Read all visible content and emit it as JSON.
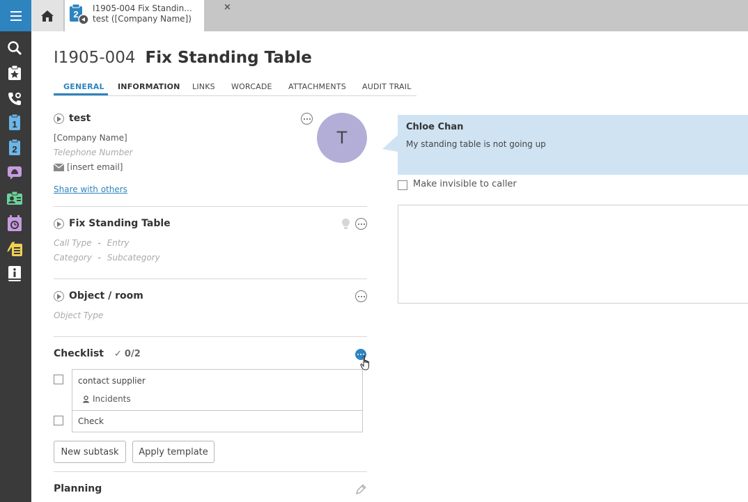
{
  "rail": {
    "items": [
      {
        "name": "search-icon"
      },
      {
        "name": "favorites-icon"
      },
      {
        "name": "phone-icon"
      },
      {
        "name": "first-line-icon",
        "label": "1"
      },
      {
        "name": "second-line-icon",
        "label": "2"
      },
      {
        "name": "problem-icon"
      },
      {
        "name": "contact-icon"
      },
      {
        "name": "planning-icon"
      },
      {
        "name": "change-icon"
      },
      {
        "name": "knowledge-icon"
      }
    ]
  },
  "open_tab": {
    "icon_label": "2",
    "line1": "I1905-004 Fix Standin...",
    "line2": "test ([Company Name])",
    "close_label": "×"
  },
  "header": {
    "number": "I1905-004",
    "title": "Fix Standing Table"
  },
  "tabs": [
    {
      "label": "GENERAL",
      "active": true
    },
    {
      "label": "INFORMATION"
    },
    {
      "label": "LINKS"
    },
    {
      "label": "WORCADE"
    },
    {
      "label": "ATTACHMENTS"
    },
    {
      "label": "AUDIT TRAIL"
    }
  ],
  "caller": {
    "title": "test",
    "company": "[Company Name]",
    "phone_placeholder": "Telephone Number",
    "email": "[insert email]",
    "share_label": "Share with others",
    "avatar_initial": "T"
  },
  "request": {
    "title": "Fix Standing Table",
    "call_type": "Call Type",
    "entry": "Entry",
    "category": "Category",
    "subcategory": "Subcategory",
    "separator": "-"
  },
  "object": {
    "title": "Object / room",
    "type_placeholder": "Object Type"
  },
  "chat": {
    "author": "Chloe Chan",
    "message": "My standing table is not going up",
    "invisible_label": "Make invisible to caller"
  },
  "checklist": {
    "title": "Checklist",
    "count": "0/2",
    "items": [
      {
        "label": "contact supplier",
        "sub": "Incidents"
      },
      {
        "label": "Check"
      }
    ],
    "new_subtask_label": "New subtask",
    "apply_template_label": "Apply template"
  },
  "planning": {
    "title": "Planning"
  },
  "colors": {
    "accent": "#2d84bf",
    "rail": "#3a3a3a",
    "bubble": "#cfe3f3",
    "avatar": "#b3aed8"
  }
}
